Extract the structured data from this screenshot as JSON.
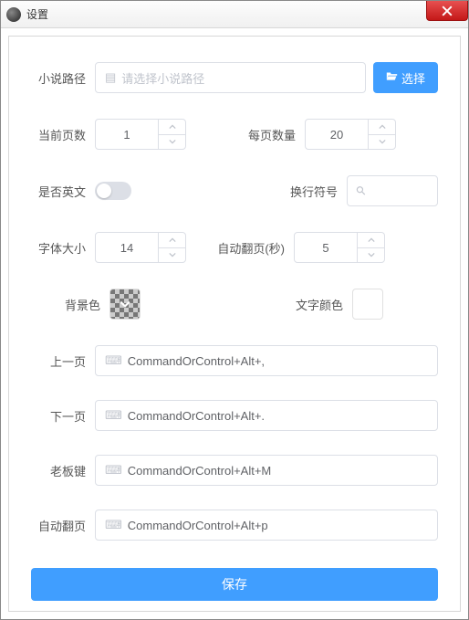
{
  "window": {
    "title": "设置"
  },
  "labels": {
    "novelPath": "小说路径",
    "currentPage": "当前页数",
    "perPage": "每页数量",
    "isEnglish": "是否英文",
    "lineBreak": "换行符号",
    "fontSize": "字体大小",
    "autoFlipSec": "自动翻页(秒)",
    "bgColor": "背景色",
    "textColor": "文字颜色",
    "prevPage": "上一页",
    "nextPage": "下一页",
    "bossKey": "老板键",
    "autoFlip": "自动翻页"
  },
  "values": {
    "novelPathPlaceholder": "请选择小说路径",
    "currentPage": "1",
    "perPage": "20",
    "isEnglish": false,
    "lineBreak": "",
    "fontSize": "14",
    "autoFlipSec": "5",
    "bgColor": "transparent",
    "textColor": "#ffffff",
    "prevPage": "CommandOrControl+Alt+,",
    "nextPage": "CommandOrControl+Alt+.",
    "bossKey": "CommandOrControl+Alt+M",
    "autoFlip": "CommandOrControl+Alt+p"
  },
  "buttons": {
    "choose": "选择",
    "save": "保存"
  }
}
